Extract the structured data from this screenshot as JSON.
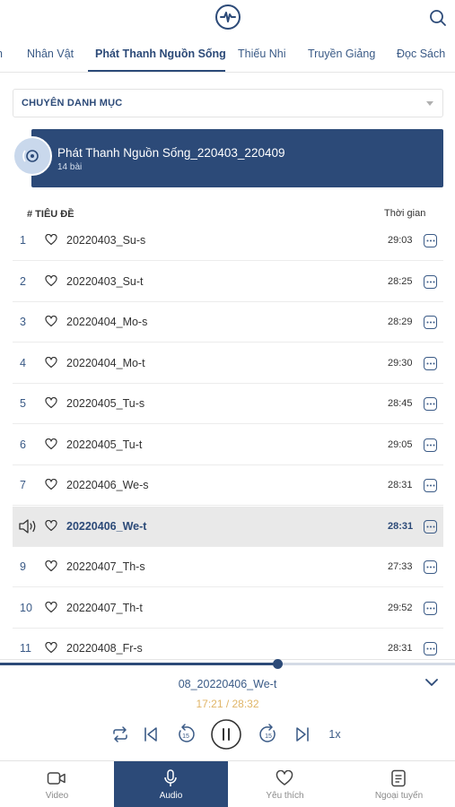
{
  "tabs": [
    {
      "label": "n"
    },
    {
      "label": "Nhân Vật"
    },
    {
      "label": "Phát Thanh Nguồn Sống"
    },
    {
      "label": "Thiếu Nhi"
    },
    {
      "label": "Truyền Giảng"
    },
    {
      "label": "Đọc Sách"
    }
  ],
  "category": {
    "label": "CHUYÊN DANH MỤC"
  },
  "playlist": {
    "title": "Phát Thanh Nguồn Sống_220403_220409",
    "count": "14 bài"
  },
  "list_header": {
    "num_title": "# TIÊU ĐỀ",
    "time": "Thời gian"
  },
  "tracks": [
    {
      "num": "1",
      "title": "20220403_Su-s",
      "duration": "29:03"
    },
    {
      "num": "2",
      "title": "20220403_Su-t",
      "duration": "28:25"
    },
    {
      "num": "3",
      "title": "20220404_Mo-s",
      "duration": "28:29"
    },
    {
      "num": "4",
      "title": "20220404_Mo-t",
      "duration": "29:30"
    },
    {
      "num": "5",
      "title": "20220405_Tu-s",
      "duration": "28:45"
    },
    {
      "num": "6",
      "title": "20220405_Tu-t",
      "duration": "29:05"
    },
    {
      "num": "7",
      "title": "20220406_We-s",
      "duration": "28:31"
    },
    {
      "num": "",
      "title": "20220406_We-t",
      "duration": "28:31"
    },
    {
      "num": "9",
      "title": "20220407_Th-s",
      "duration": "27:33"
    },
    {
      "num": "10",
      "title": "20220407_Th-t",
      "duration": "29:52"
    },
    {
      "num": "11",
      "title": "20220408_Fr-s",
      "duration": "28:31"
    }
  ],
  "player": {
    "title": "08_20220406_We-t",
    "time": "17:21 / 28:32",
    "progress": 0.61,
    "speed": "1x"
  },
  "nav": [
    {
      "label": "Video",
      "icon": "video-icon"
    },
    {
      "label": "Audio",
      "icon": "microphone-icon"
    },
    {
      "label": "Yêu thích",
      "icon": "heart-icon"
    },
    {
      "label": "Ngoại tuyến",
      "icon": "offline-doc-icon"
    }
  ],
  "colors": {
    "primary": "#2c4a78",
    "accent_time": "#e0b567",
    "playing_row": "#e9e9e9"
  }
}
